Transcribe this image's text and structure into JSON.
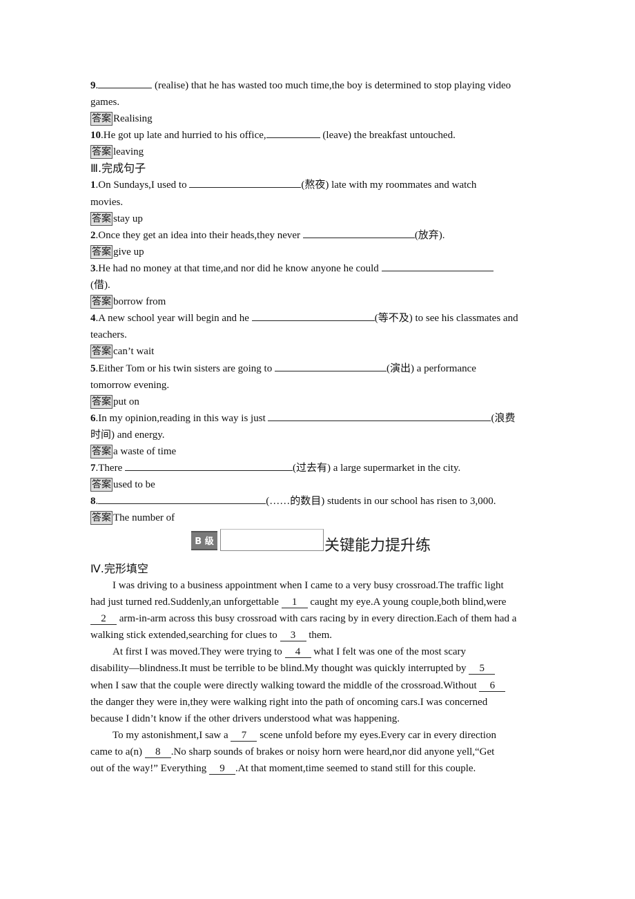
{
  "answer_label": "答案",
  "grammar_fill": {
    "items": [
      {
        "num": "9",
        "pre": ".",
        "post": " (realise) that he has wasted too much time,the boy is determined to stop playing video",
        "cont": "games.",
        "answer": "Realising"
      },
      {
        "num": "10",
        "pre": ".He got up late and hurried to his office,",
        "post": " (leave) the breakfast untouched.",
        "answer": "leaving"
      }
    ]
  },
  "section3": {
    "title": "Ⅲ.完成句子",
    "items": [
      {
        "num": "1",
        "pre": ".On Sundays,I used to ",
        "post": "(熬夜) late with my roommates and watch",
        "cont": "movies.",
        "answer": "stay up"
      },
      {
        "num": "2",
        "pre": ".Once they get an idea into their heads,they never ",
        "post": "(放弃).",
        "answer": "give up"
      },
      {
        "num": "3",
        "pre": ".He had no money at that time,and nor did he know anyone he could ",
        "post": "",
        "cont": "(借).",
        "answer": "borrow from"
      },
      {
        "num": "4",
        "pre": ".A new school year will begin and he ",
        "post": "(等不及) to see his classmates and",
        "cont": "teachers.",
        "answer": "can’t wait"
      },
      {
        "num": "5",
        "pre": ".Either Tom or his twin sisters are going to ",
        "post": "(演出) a performance",
        "cont": "tomorrow evening.",
        "answer": "put on"
      },
      {
        "num": "6",
        "pre": ".In my opinion,reading in this way is just ",
        "post": "(浪费",
        "cont": "时间) and energy.",
        "answer": "a waste of time"
      },
      {
        "num": "7",
        "pre": ".There ",
        "post": "(过去有) a large supermarket in the city.",
        "answer": "used to be"
      },
      {
        "num": "8",
        "pre": ".",
        "post": "(……的数目) students in our school has risen to 3,000.",
        "answer": "The number of"
      }
    ]
  },
  "level_banner": {
    "tag": "B 级",
    "title": "关键能力提升练"
  },
  "section4": {
    "title": "Ⅳ.完形填空",
    "lines": [
      {
        "indent": true,
        "parts": [
          "I was driving to a business appointment when I came to a very busy crossroad.The traffic light"
        ]
      },
      {
        "indent": false,
        "parts": [
          "had just turned red.Suddenly,an unforgettable ",
          {
            "blank": "1"
          },
          " caught my eye.A young couple,both blind,were"
        ]
      },
      {
        "indent": false,
        "parts": [
          {
            "blank": "2"
          },
          " arm-in-arm across this busy crossroad with cars racing by in every direction.Each of them had a"
        ]
      },
      {
        "indent": false,
        "parts": [
          "walking stick extended,searching for clues to ",
          {
            "blank": "3"
          },
          " them."
        ]
      },
      {
        "indent": true,
        "parts": [
          "At first I was moved.They were trying to ",
          {
            "blank": "4"
          },
          " what I felt was one of the most scary"
        ]
      },
      {
        "indent": false,
        "parts": [
          "disability—blindness.It must be terrible to be blind.My thought was quickly interrupted by ",
          {
            "blank": "5"
          }
        ]
      },
      {
        "indent": false,
        "parts": [
          "when I saw that the couple were directly walking toward the middle of the crossroad.Without ",
          {
            "blank": "6"
          }
        ]
      },
      {
        "indent": false,
        "parts": [
          "the danger they were in,they were walking right into the path of oncoming cars.I was concerned"
        ]
      },
      {
        "indent": false,
        "parts": [
          "because I didn’t know if the other drivers understood what was happening."
        ]
      },
      {
        "indent": true,
        "parts": [
          "To my astonishment,I saw a ",
          {
            "blank": "7"
          },
          " scene unfold before my eyes.Every car in every direction"
        ]
      },
      {
        "indent": false,
        "parts": [
          "came to a(n) ",
          {
            "blank": "8"
          },
          ".No sharp sounds of brakes or noisy horn were heard,nor did anyone yell,“Get"
        ]
      },
      {
        "indent": false,
        "parts": [
          "out of the way!” Everything ",
          {
            "blank": "9"
          },
          ".At that moment,time seemed to stand still for this couple."
        ]
      }
    ]
  }
}
